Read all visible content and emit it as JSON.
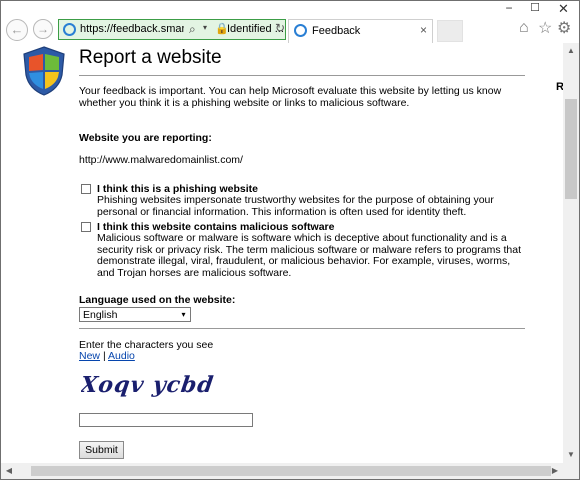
{
  "browser": {
    "address_url": "https://feedback.smartscre...",
    "identity_label": "Identified ...",
    "tab_title": "Feedback",
    "back_glyph": "←",
    "forward_glyph": "→",
    "search_glyph": "⌕",
    "lock_glyph": "🔒",
    "refresh_glyph": "↻",
    "close_glyph": "×",
    "dropdown_glyph": "▾",
    "minimize_glyph": "−",
    "maximize_glyph": "☐",
    "window_close_glyph": "✕",
    "home_glyph": "⌂",
    "favorites_glyph": "☆",
    "settings_glyph": "⚙",
    "icons": [
      "back-arrow-icon",
      "forward-arrow-icon",
      "ie-favicon-icon",
      "search-icon",
      "lock-icon",
      "refresh-icon",
      "tab-close-icon",
      "home-icon",
      "favorites-star-icon",
      "settings-gear-icon"
    ],
    "accent_color": "#3c9d46"
  },
  "page": {
    "title": "Report a website",
    "intro": "Your feedback is important. You can help Microsoft evaluate this website by letting us know whether you think it is a phishing website or links to malicious software.",
    "reporting_label": "Website you are reporting:",
    "reporting_url": "http://www.malwaredomainlist.com/",
    "phishing": {
      "label": "I think this is a phishing website",
      "description": "Phishing websites impersonate trustworthy websites for the purpose of obtaining your personal or financial information. This information is often used for identity theft.",
      "checked": false
    },
    "malware": {
      "label": "I think this website contains malicious software",
      "description": "Malicious software or malware is software which is deceptive about functionality and is a security risk or privacy risk. The term malicious software or malware refers to programs that demonstrate illegal, viral, fraudulent, or malicious behavior. For example, viruses, worms, and Trojan horses are malicious software.",
      "checked": false
    },
    "language_label": "Language used on the website:",
    "language_selected": "English",
    "captcha_prompt": "Enter the characters you see",
    "captcha_new_link": "New",
    "captcha_separator": "|",
    "captcha_audio_link": "Audio",
    "captcha_text": "Xoqv ycbd",
    "captcha_input_value": "",
    "submit_label": "Submit",
    "right_edge_letter": "R"
  },
  "scroll": {
    "up_glyph": "▲",
    "down_glyph": "▼",
    "left_glyph": "◀",
    "right_glyph": "▶"
  }
}
